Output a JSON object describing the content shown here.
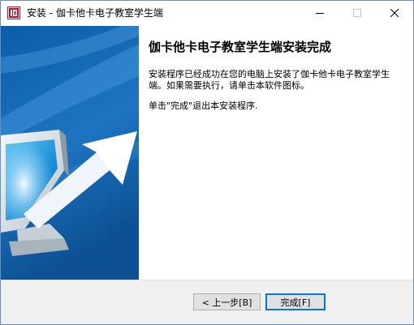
{
  "window": {
    "title": "安装 - 伽卡他卡电子教室学生端",
    "accent": "#0078d7",
    "app_icon": "app-logo-icon"
  },
  "titlebar_controls": {
    "minimize_icon": "minimize-icon",
    "maximize_icon": "maximize-icon",
    "close_icon": "close-icon"
  },
  "sidebar": {
    "image": "monitor-arrow-illustration"
  },
  "content": {
    "heading": "伽卡他卡电子教室学生端安装完成",
    "body": "安装程序已经成功在您的电脑上安装了伽卡他卡电子教室学生端。如果需要执行，请单击本软件图标。",
    "hint": "单击\"完成\"退出本安装程序."
  },
  "footer": {
    "back_label": "< 上一步[B]",
    "finish_label": "完成[F]"
  }
}
